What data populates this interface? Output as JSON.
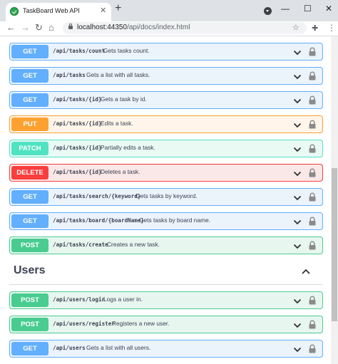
{
  "browser": {
    "tab_title": "TaskBoard Web API",
    "tab_close": "✕",
    "new_tab": "+",
    "url_host": "localhost:44350",
    "url_path": "/api/docs/index.html",
    "win_minimize": "—",
    "win_maximize": "☐",
    "win_close": "✕",
    "back": "←",
    "forward": "→",
    "reload": "↻",
    "home": "⌂",
    "star": "☆",
    "extensions": "✚",
    "menu": "⋮"
  },
  "operations_top": [
    {
      "method": "GET",
      "kind": "get",
      "path": "/api/tasks/count",
      "summary": "Gets tasks count."
    },
    {
      "method": "GET",
      "kind": "get",
      "path": "/api/tasks",
      "summary": "Gets a list with all tasks."
    },
    {
      "method": "GET",
      "kind": "get",
      "path": "/api/tasks/{id}",
      "summary": "Gets a task by id."
    },
    {
      "method": "PUT",
      "kind": "put",
      "path": "/api/tasks/{id}",
      "summary": "Edits a task."
    },
    {
      "method": "PATCH",
      "kind": "patch",
      "path": "/api/tasks/{id}",
      "summary": "Partially edits a task."
    },
    {
      "method": "DELETE",
      "kind": "delete",
      "path": "/api/tasks/{id}",
      "summary": "Deletes a task."
    },
    {
      "method": "GET",
      "kind": "get",
      "path": "/api/tasks/search/{keyword}",
      "summary": "Gets tasks by keyword."
    },
    {
      "method": "GET",
      "kind": "get",
      "path": "/api/tasks/board/{boardName}",
      "summary": "Gets tasks by board name."
    },
    {
      "method": "POST",
      "kind": "post",
      "path": "/api/tasks/create",
      "summary": "Creates a new task."
    }
  ],
  "users_section": {
    "title": "Users",
    "operations": [
      {
        "method": "POST",
        "kind": "post",
        "path": "/api/users/login",
        "summary": "Logs a user in."
      },
      {
        "method": "POST",
        "kind": "post",
        "path": "/api/users/register",
        "summary": "Registers a new user."
      },
      {
        "method": "GET",
        "kind": "get",
        "path": "/api/users",
        "summary": "Gets a list with all users."
      }
    ]
  },
  "colors": {
    "get": "#61affe",
    "put": "#fca130",
    "patch": "#50e3c2",
    "delete": "#f93e3e",
    "post": "#49cc90"
  }
}
